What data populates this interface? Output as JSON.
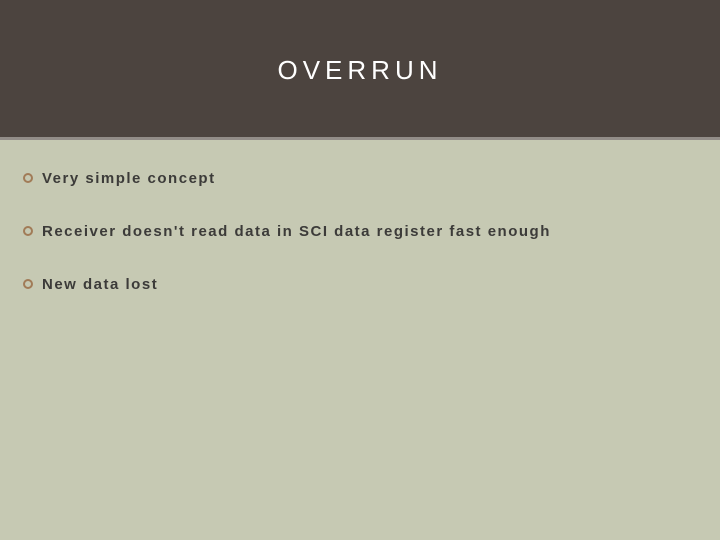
{
  "title": "OVERRUN",
  "bullets": [
    "Very simple concept",
    "Receiver doesn't read data in SCI data register fast enough",
    "New data lost"
  ]
}
